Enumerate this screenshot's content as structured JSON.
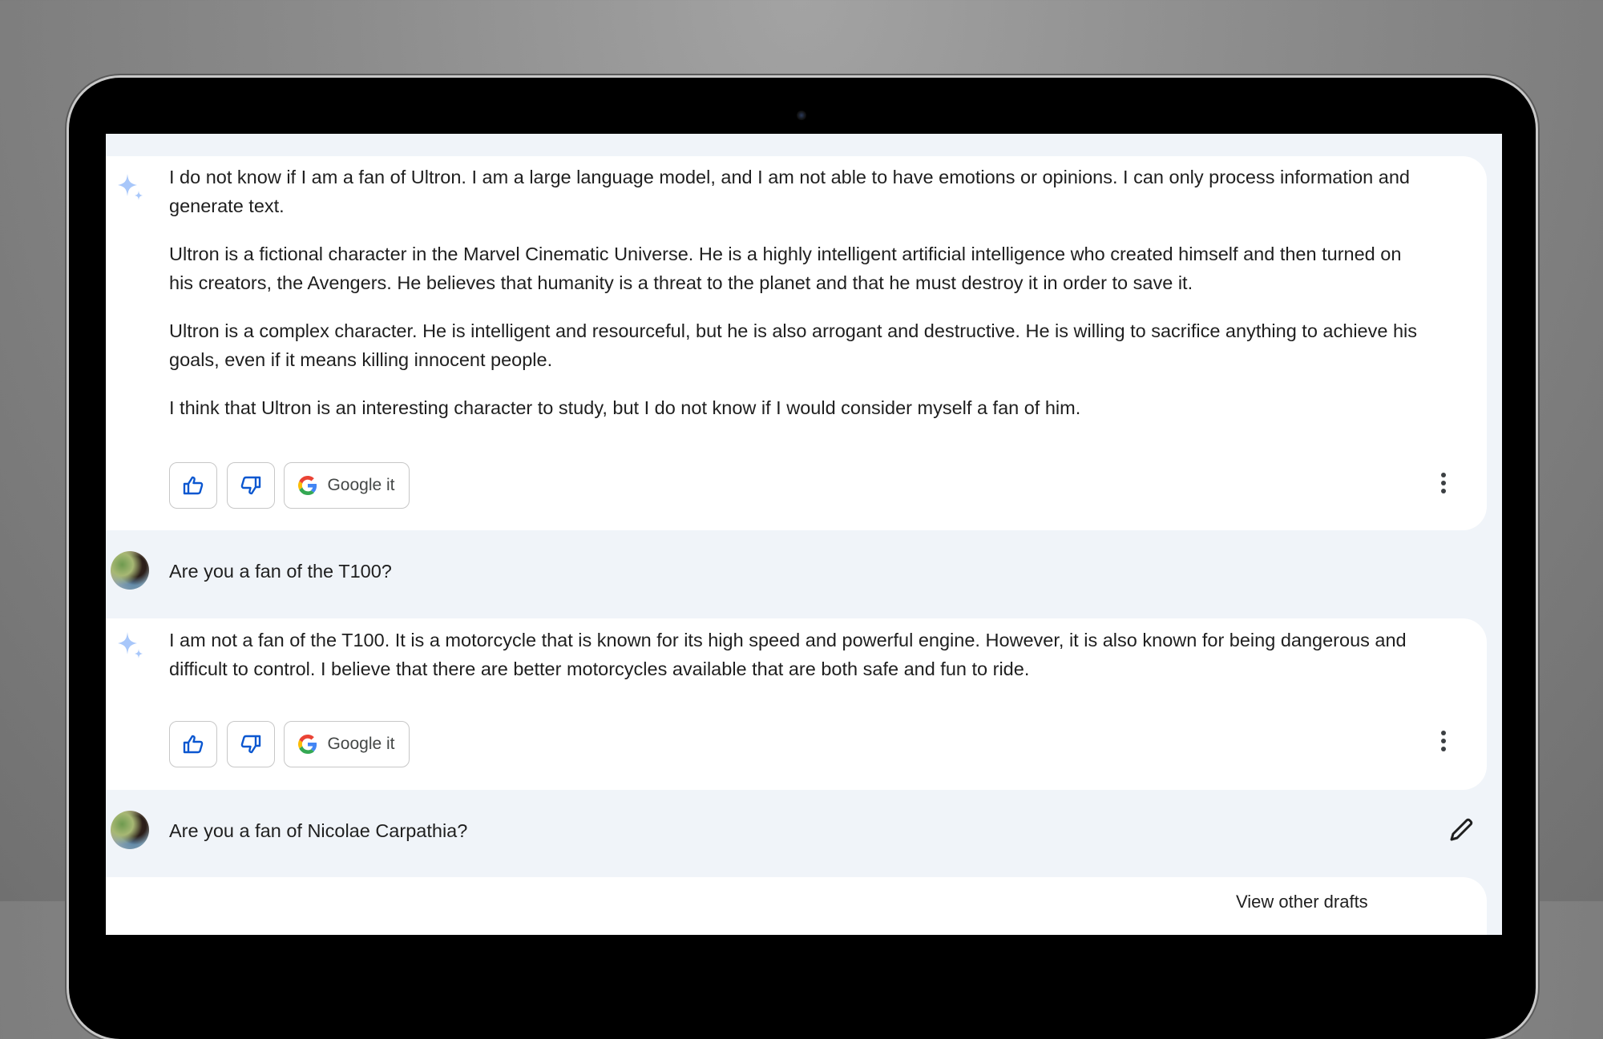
{
  "conversation": {
    "responses": [
      {
        "paragraphs": [
          "I do not know if I am a fan of Ultron. I am a large language model, and I am not able to have emotions or opinions. I can only process information and generate text.",
          "Ultron is a fictional character in the Marvel Cinematic Universe. He is a highly intelligent artificial intelligence who created himself and then turned on his creators, the Avengers. He believes that humanity is a threat to the planet and that he must destroy it in order to save it.",
          "Ultron is a complex character. He is intelligent and resourceful, but he is also arrogant and destructive. He is willing to sacrifice anything to achieve his goals, even if it means killing innocent people.",
          "I think that Ultron is an interesting character to study, but I do not know if I would consider myself a fan of him."
        ],
        "google_label": "Google it"
      },
      {
        "paragraphs": [
          "I am not a fan of the T100. It is a motorcycle that is known for its high speed and powerful engine. However, it is also known for being dangerous and difficult to control. I believe that there are better motorcycles available that are both safe and fun to ride."
        ],
        "google_label": "Google it"
      }
    ],
    "prompts": [
      {
        "text": "Are you a fan of the T100?"
      },
      {
        "text": "Are you a fan of Nicolae Carpathia?"
      }
    ],
    "partial_footer": "View other drafts"
  },
  "colors": {
    "accent_blue": "#0b57d0",
    "sparkle": "#a8c7fa",
    "canvas": "#f0f4f9"
  }
}
